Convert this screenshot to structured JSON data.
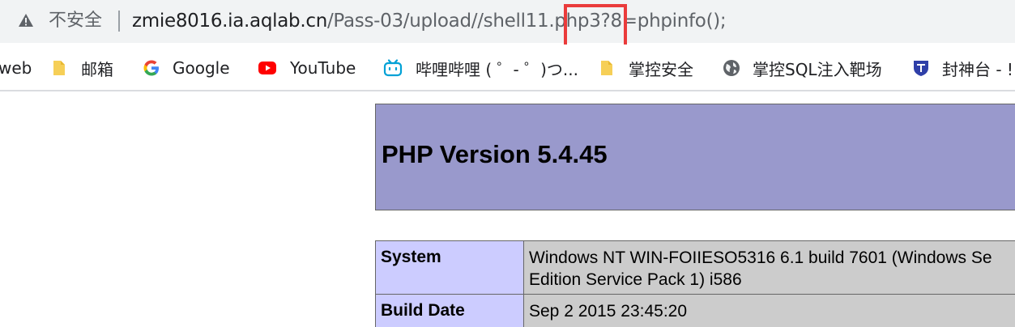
{
  "address_bar": {
    "security_label": "不安全",
    "url_host": "zmie8016.ia.aqlab.cn",
    "url_path": "/Pass-03/upload//shell11.php3?8=phpinfo();",
    "warning_color": "#5f6368",
    "highlight_color": "#ea3b3b"
  },
  "bookmarks": [
    {
      "label": "web",
      "icon": "none"
    },
    {
      "label": "邮箱",
      "icon": "folder-icon"
    },
    {
      "label": "Google",
      "icon": "google-icon"
    },
    {
      "label": "YouTube",
      "icon": "youtube-icon"
    },
    {
      "label": "哔哩哔哩 ( ゜- ゜)つ...",
      "icon": "bilibili-icon"
    },
    {
      "label": "掌控安全",
      "icon": "folder-icon"
    },
    {
      "label": "掌控SQL注入靶场",
      "icon": "globe-icon"
    },
    {
      "label": "封神台 - !",
      "icon": "shield-icon"
    }
  ],
  "phpinfo": {
    "title": "PHP Version 5.4.45",
    "header_color": "#9999cc",
    "rows": [
      {
        "key": "System",
        "value": "Windows NT WIN-FOIIESO5316 6.1 build 7601 (Windows Se Edition Service Pack 1) i586"
      },
      {
        "key": "Build Date",
        "value": "Sep 2 2015 23:45:20"
      }
    ]
  }
}
